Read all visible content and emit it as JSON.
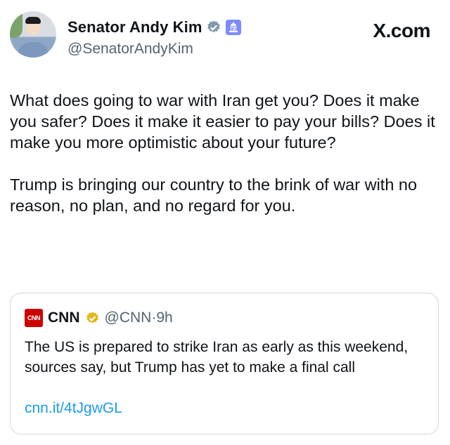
{
  "author": {
    "name": "Senator Andy Kim",
    "handle": "@SenatorAndyKim"
  },
  "site_label": "X.com",
  "tweet": {
    "paragraph1": "What does going to war with Iran get you? Does it make you safer? Does it make it easier to pay your bills? Does it make you more optimistic about your future?",
    "paragraph2": "Trump is bringing our country to the brink of war with no reason, no plan, and no regard for you."
  },
  "quoted": {
    "logo_text": "CNN",
    "name": "CNN",
    "handle": "@CNN",
    "separator": "·",
    "time": "9h",
    "text": "The US is prepared to strike Iran as early as this weekend, sources say, but Trump has yet to make a final call",
    "link": "cnn.it/4tJgwGL"
  },
  "colors": {
    "gov_badge": "#829aab",
    "gold_badge": "#e2b719",
    "link": "#1d9bf0",
    "cnn_red": "#cc0000"
  }
}
